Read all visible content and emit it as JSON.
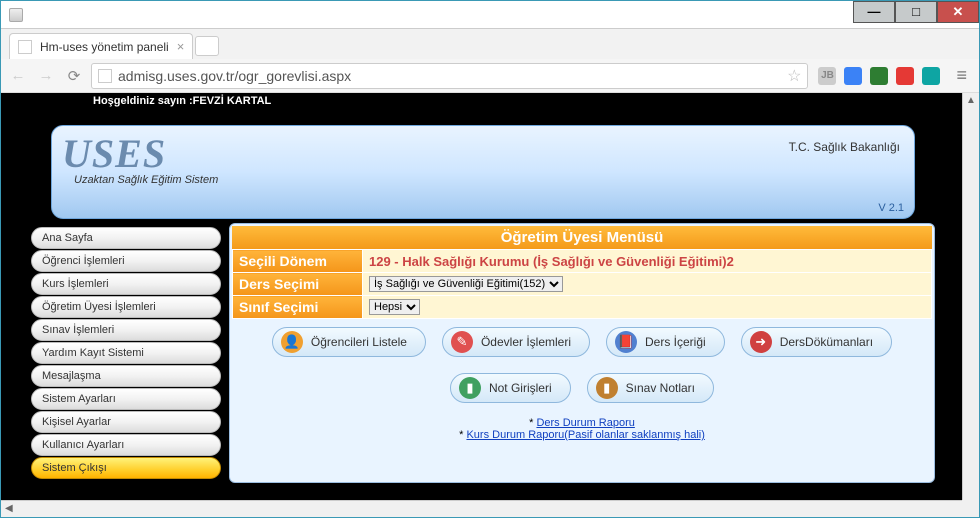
{
  "window": {
    "app_name": ""
  },
  "tab": {
    "title": "Hm-uses yönetim paneli"
  },
  "addressbar": {
    "url": "admisg.uses.gov.tr/ogr_gorevlisi.aspx"
  },
  "extensions": [
    "JB",
    "",
    "",
    "",
    ""
  ],
  "welcome_prefix": "Hoşgeldiniz sayın :",
  "welcome_user": "FEVZİ KARTAL",
  "banner": {
    "logo": "USES",
    "subtitle": "Uzaktan Sağlık Eğitim Sistem",
    "ministry": "T.C.   Sağlık Bakanlığı",
    "version": "V  2.1"
  },
  "sidebar": {
    "items": [
      "Ana Sayfa",
      "Öğrenci İşlemleri",
      "Kurs İşlemleri",
      "Öğretim Üyesi İşlemleri",
      "Sınav İşlemleri",
      "Yardım Kayıt Sistemi",
      "Mesajlaşma",
      "Sistem Ayarları",
      "Kişisel Ayarlar",
      "Kullanıcı Ayarları",
      "Sistem Çıkışı"
    ],
    "active_index": 10
  },
  "main": {
    "title": "Öğretim Üyesi Menüsü",
    "rows": [
      {
        "label": "Seçili Dönem",
        "type": "text",
        "value": "129 - Halk Sağlığı Kurumu (İş Sağlığı ve Güvenliği Eğitimi)2"
      },
      {
        "label": "Ders Seçimi",
        "type": "select",
        "value": "İş Sağlığı ve Güvenliği Eğitimi(152)"
      },
      {
        "label": "Sınıf Seçimi",
        "type": "select",
        "value": "Hepsi"
      }
    ],
    "actions_row1": [
      "Öğrencileri Listele",
      "Ödevler İşlemleri",
      "Ders İçeriği",
      "DersDökümanları"
    ],
    "actions_row2": [
      "Not Girişleri",
      "Sınav Notları"
    ],
    "reports": {
      "r1": "Ders Durum Raporu",
      "r2": "Kurs Durum Raporu(Pasif olanlar saklanmış hali)"
    }
  }
}
